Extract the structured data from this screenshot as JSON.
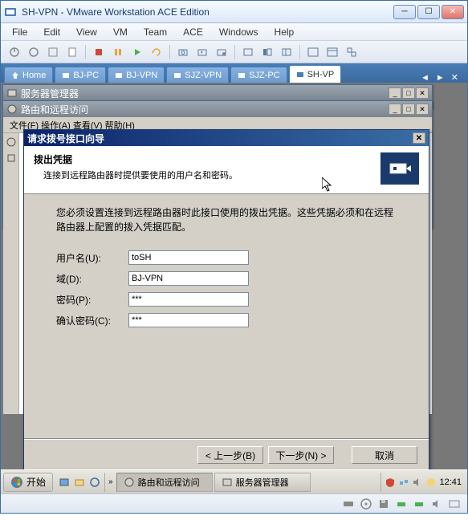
{
  "window": {
    "title": "SH-VPN - VMware Workstation ACE Edition",
    "menu": [
      "File",
      "Edit",
      "View",
      "VM",
      "Team",
      "ACE",
      "Windows",
      "Help"
    ],
    "tabs": [
      {
        "label": "Home",
        "icon": "home"
      },
      {
        "label": "BJ-PC",
        "icon": "vm"
      },
      {
        "label": "BJ-VPN",
        "icon": "vm"
      },
      {
        "label": "SJZ-VPN",
        "icon": "vm"
      },
      {
        "label": "SJZ-PC",
        "icon": "vm"
      },
      {
        "label": "SH-VP",
        "icon": "vm",
        "active": true
      }
    ]
  },
  "guest": {
    "win_server": {
      "title": "服务器管理器"
    },
    "win_routing": {
      "title": "路由和远程访问",
      "menu_fragment": "文件(F)  操作(A)  查看(V)  帮助(H)"
    },
    "wizard": {
      "title": "请求拨号接口向导",
      "header_title": "拨出凭据",
      "header_sub": "连接到远程路由器时提供要使用的用户名和密码。",
      "body_desc": "您必须设置连接到远程路由器时此接口使用的拨出凭据。这些凭据必须和在远程路由器上配置的拨入凭据匹配。",
      "form": {
        "username_label": "用户名(U):",
        "username_value": "toSH",
        "domain_label": "域(D):",
        "domain_value": "BJ-VPN",
        "password_label": "密码(P):",
        "password_value": "***",
        "confirm_label": "确认密码(C):",
        "confirm_value": "***"
      },
      "buttons": {
        "back": "< 上一步(B)",
        "next": "下一步(N) >",
        "cancel": "取消"
      }
    },
    "taskbar": {
      "start": "开始",
      "tasks": [
        {
          "label": "路由和远程访问",
          "active": true
        },
        {
          "label": "服务器管理器",
          "active": false
        }
      ],
      "clock": "12:41"
    }
  }
}
